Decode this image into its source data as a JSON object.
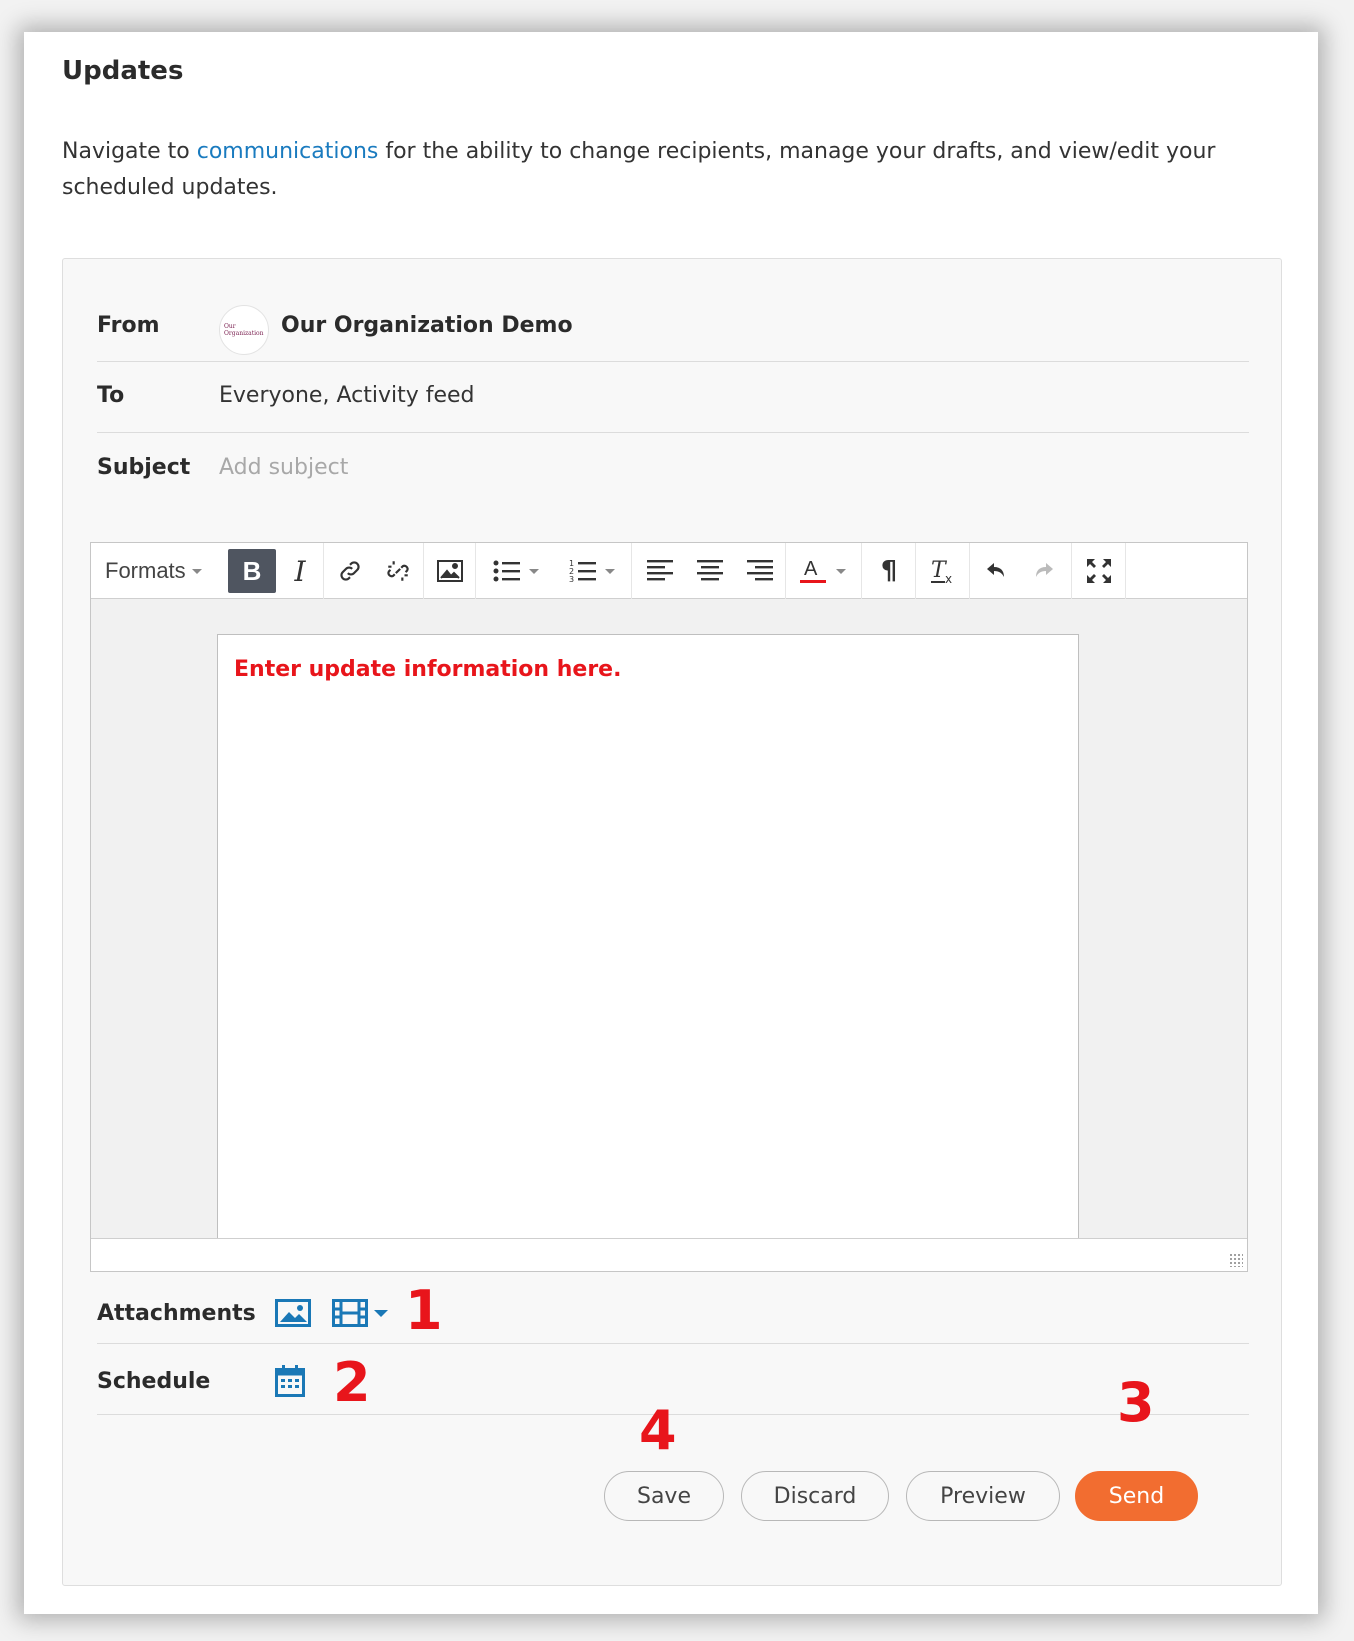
{
  "header": {
    "title": "Updates",
    "intro_prefix": "Navigate to ",
    "intro_link": "communications",
    "intro_suffix": " for the ability to change recipients, manage your drafts, and view/edit your scheduled updates."
  },
  "form": {
    "from_label": "From",
    "from_value": "Our Organization Demo",
    "avatar_line1": "Our",
    "avatar_line2": "Organization",
    "to_label": "To",
    "to_value": "Everyone, Activity feed",
    "subject_label": "Subject",
    "subject_placeholder": "Add subject",
    "attachments_label": "Attachments",
    "schedule_label": "Schedule"
  },
  "editor": {
    "formats_label": "Formats",
    "bold_label": "B",
    "body_text": "Enter update information here.",
    "text_color": "#e8151b",
    "toolbar_icons": [
      "bold-icon",
      "italic-icon",
      "link-icon",
      "unlink-icon",
      "image-icon",
      "bullet-list-icon",
      "numbered-list-icon",
      "align-left-icon",
      "align-center-icon",
      "align-right-icon",
      "text-color-icon",
      "paragraph-icon",
      "clear-format-icon",
      "undo-icon",
      "redo-icon",
      "fullscreen-icon"
    ]
  },
  "markers": {
    "m1": "1",
    "m2": "2",
    "m3": "3",
    "m4": "4"
  },
  "actions": {
    "save": "Save",
    "discard": "Discard",
    "preview": "Preview",
    "send": "Send"
  },
  "colors": {
    "accent": "#1a78b6",
    "send": "#f26d30",
    "marker": "#e8151b",
    "link": "#1a7bbf"
  }
}
